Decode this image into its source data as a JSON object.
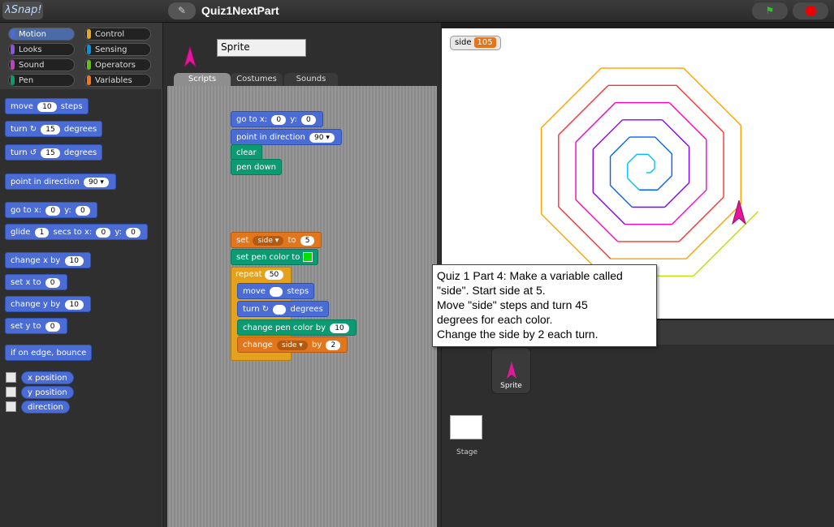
{
  "header": {
    "logo": "λSnap!",
    "project_title": "Quiz1NextPart"
  },
  "categories": [
    {
      "label": "Motion",
      "color": "#4a6cd4"
    },
    {
      "label": "Control",
      "color": "#e6a822"
    },
    {
      "label": "Looks",
      "color": "#8a55d7"
    },
    {
      "label": "Sensing",
      "color": "#0494dc"
    },
    {
      "label": "Sound",
      "color": "#bb42c3"
    },
    {
      "label": "Operators",
      "color": "#62c213"
    },
    {
      "label": "Pen",
      "color": "#0e9a6c"
    },
    {
      "label": "Variables",
      "color": "#f3761d"
    }
  ],
  "palette": {
    "move": "move",
    "move_val": "10",
    "steps": "steps",
    "turn": "turn ↻",
    "turn_val": "15",
    "degrees": "degrees",
    "turn2": "turn ↺",
    "turn2_val": "15",
    "pid": "point in direction",
    "pid_val": "90 ▾",
    "goto_a": "go to x:",
    "goto_x": "0",
    "goto_b": "y:",
    "goto_y": "0",
    "glide_a": "glide",
    "glide_v": "1",
    "glide_b": "secs to x:",
    "glide_x": "0",
    "glide_c": "y:",
    "glide_y": "0",
    "cx": "change x by",
    "cx_v": "10",
    "sx": "set x to",
    "sx_v": "0",
    "cy": "change y by",
    "cy_v": "10",
    "sy": "set y to",
    "sy_v": "0",
    "bounce": "if on edge, bounce",
    "rep1": "x position",
    "rep2": "y position",
    "rep3": "direction"
  },
  "sprite": {
    "name": "Sprite"
  },
  "tabs": [
    {
      "label": "Scripts"
    },
    {
      "label": "Costumes"
    },
    {
      "label": "Sounds"
    }
  ],
  "script1": {
    "goto_a": "go to x:",
    "goto_x": "0",
    "goto_b": "y:",
    "goto_y": "0",
    "pid": "point in direction",
    "pid_v": "90 ▾",
    "clear": "clear",
    "pendown": "pen down"
  },
  "script2": {
    "set": "set",
    "var": "side ▾",
    "to": "to",
    "set_v": "5",
    "pencolor": "set pen color to",
    "repeat": "repeat",
    "repeat_v": "50",
    "move": "move",
    "steps": "steps",
    "turn": "turn ↻",
    "degrees": "degrees",
    "cpc": "change pen color by",
    "cpc_v": "10",
    "change": "change",
    "change_var": "side ▾",
    "by": "by",
    "change_v": "2"
  },
  "stage": {
    "watcher_label": "side",
    "watcher_value": "105"
  },
  "corral": {
    "sprite_label": "Sprite",
    "stage_label": "Stage"
  },
  "note": {
    "l1": "Quiz 1 Part 4:  Make a variable called",
    "l2": "\"side\".   Start side at 5.",
    "l3": "  Move \"side\" steps and turn 45",
    "l4": "degrees for each color.",
    "l5": "Change the side by 2 each turn."
  }
}
